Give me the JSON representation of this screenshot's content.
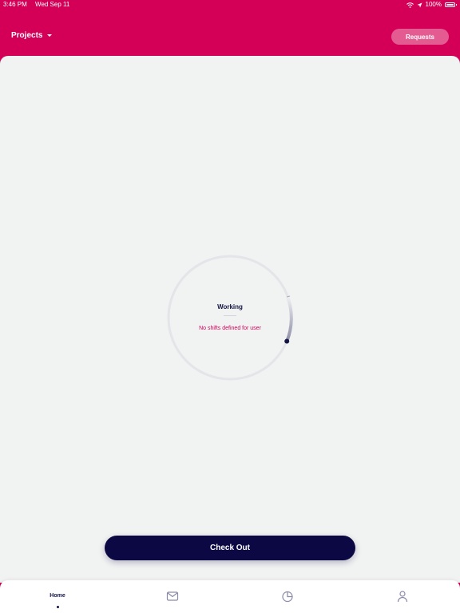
{
  "status_bar": {
    "time": "3:46 PM",
    "date": "Wed Sep 11",
    "battery": "100%",
    "icons": [
      "wifi-icon",
      "location-icon",
      "battery-icon"
    ]
  },
  "header": {
    "projects_label": "Projects",
    "requests_label": "Requests"
  },
  "status": {
    "title": "Working",
    "message": "No shifts defined for user"
  },
  "actions": {
    "checkout_label": "Check Out"
  },
  "tabbar": {
    "home_label": "Home",
    "tabs": [
      "home",
      "messages-icon",
      "stats-icon",
      "profile-icon"
    ]
  },
  "colors": {
    "brand": "#d40058",
    "navy": "#0b0843",
    "background": "#f1f2f2",
    "pill": "#e45b91"
  }
}
